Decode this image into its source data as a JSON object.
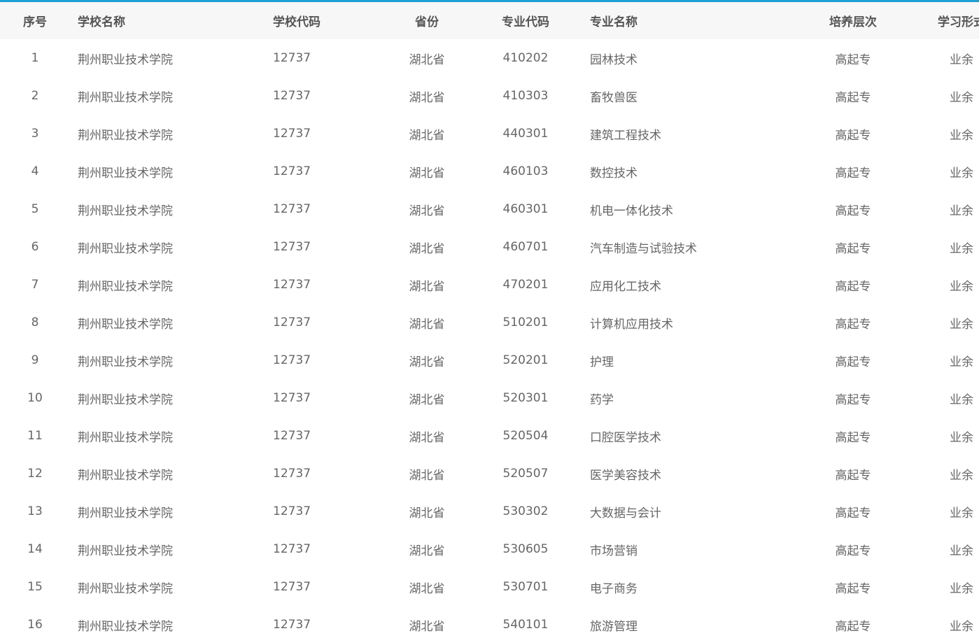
{
  "table": {
    "headers": [
      "序号",
      "学校名称",
      "学校代码",
      "省份",
      "专业代码",
      "专业名称",
      "培养层次",
      "学习形式"
    ],
    "rows": [
      [
        "1",
        "荆州职业技术学院",
        "12737",
        "湖北省",
        "410202",
        "园林技术",
        "高起专",
        "业余"
      ],
      [
        "2",
        "荆州职业技术学院",
        "12737",
        "湖北省",
        "410303",
        "畜牧兽医",
        "高起专",
        "业余"
      ],
      [
        "3",
        "荆州职业技术学院",
        "12737",
        "湖北省",
        "440301",
        "建筑工程技术",
        "高起专",
        "业余"
      ],
      [
        "4",
        "荆州职业技术学院",
        "12737",
        "湖北省",
        "460103",
        "数控技术",
        "高起专",
        "业余"
      ],
      [
        "5",
        "荆州职业技术学院",
        "12737",
        "湖北省",
        "460301",
        "机电一体化技术",
        "高起专",
        "业余"
      ],
      [
        "6",
        "荆州职业技术学院",
        "12737",
        "湖北省",
        "460701",
        "汽车制造与试验技术",
        "高起专",
        "业余"
      ],
      [
        "7",
        "荆州职业技术学院",
        "12737",
        "湖北省",
        "470201",
        "应用化工技术",
        "高起专",
        "业余"
      ],
      [
        "8",
        "荆州职业技术学院",
        "12737",
        "湖北省",
        "510201",
        "计算机应用技术",
        "高起专",
        "业余"
      ],
      [
        "9",
        "荆州职业技术学院",
        "12737",
        "湖北省",
        "520201",
        "护理",
        "高起专",
        "业余"
      ],
      [
        "10",
        "荆州职业技术学院",
        "12737",
        "湖北省",
        "520301",
        "药学",
        "高起专",
        "业余"
      ],
      [
        "11",
        "荆州职业技术学院",
        "12737",
        "湖北省",
        "520504",
        "口腔医学技术",
        "高起专",
        "业余"
      ],
      [
        "12",
        "荆州职业技术学院",
        "12737",
        "湖北省",
        "520507",
        "医学美容技术",
        "高起专",
        "业余"
      ],
      [
        "13",
        "荆州职业技术学院",
        "12737",
        "湖北省",
        "530302",
        "大数据与会计",
        "高起专",
        "业余"
      ],
      [
        "14",
        "荆州职业技术学院",
        "12737",
        "湖北省",
        "530605",
        "市场营销",
        "高起专",
        "业余"
      ],
      [
        "15",
        "荆州职业技术学院",
        "12737",
        "湖北省",
        "530701",
        "电子商务",
        "高起专",
        "业余"
      ],
      [
        "16",
        "荆州职业技术学院",
        "12737",
        "湖北省",
        "540101",
        "旅游管理",
        "高起专",
        "业余"
      ]
    ]
  },
  "colors": {
    "accent": "#1e9fd6",
    "header_bg": "#f7f7f7",
    "text": "#666666"
  }
}
